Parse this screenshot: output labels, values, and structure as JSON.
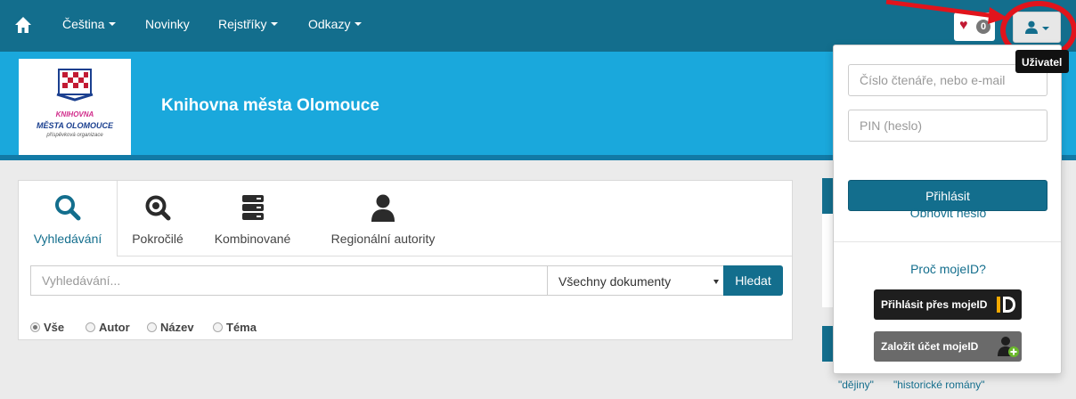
{
  "navbar": {
    "language": "Čeština",
    "news": "Novinky",
    "registers": "Rejstříky",
    "links": "Odkazy",
    "favorites_count": "0"
  },
  "banner": {
    "logo_line1": "KNIHOVNA",
    "logo_line2": "MĚSTA OLOMOUCE",
    "logo_line3": "příspěvková organizace",
    "title": "Knihovna města Olomouce"
  },
  "search": {
    "tabs": [
      {
        "label": "Vyhledávání"
      },
      {
        "label": "Pokročilé"
      },
      {
        "label": "Kombinované"
      },
      {
        "label": "Regionální autority"
      }
    ],
    "placeholder": "Vyhledávání...",
    "doc_type": "Všechny dokumenty",
    "button": "Hledat",
    "radios": [
      {
        "label": "Vše",
        "checked": true
      },
      {
        "label": "Autor",
        "checked": false
      },
      {
        "label": "Název",
        "checked": false
      },
      {
        "label": "Téma",
        "checked": false
      }
    ]
  },
  "login_dropdown": {
    "tooltip": "Uživatel",
    "reader_placeholder": "Číslo čtenáře, nebo e-mail",
    "pin_placeholder": "PIN (heslo)",
    "login_button": "Přihlásit",
    "reset_password": "Obnovit heslo",
    "why_mojeid": "Proč mojeID?",
    "login_mojeid": "Přihlásit přes mojeID",
    "create_mojeid": "Založit účet mojeID"
  },
  "sidebar_tags": [
    "\"dějiny\"",
    "\"historické romány\""
  ],
  "colors": {
    "navbar": "#136e8d",
    "banner": "#1aa8dc",
    "accent": "#136e8d",
    "callout": "#e1141c"
  }
}
